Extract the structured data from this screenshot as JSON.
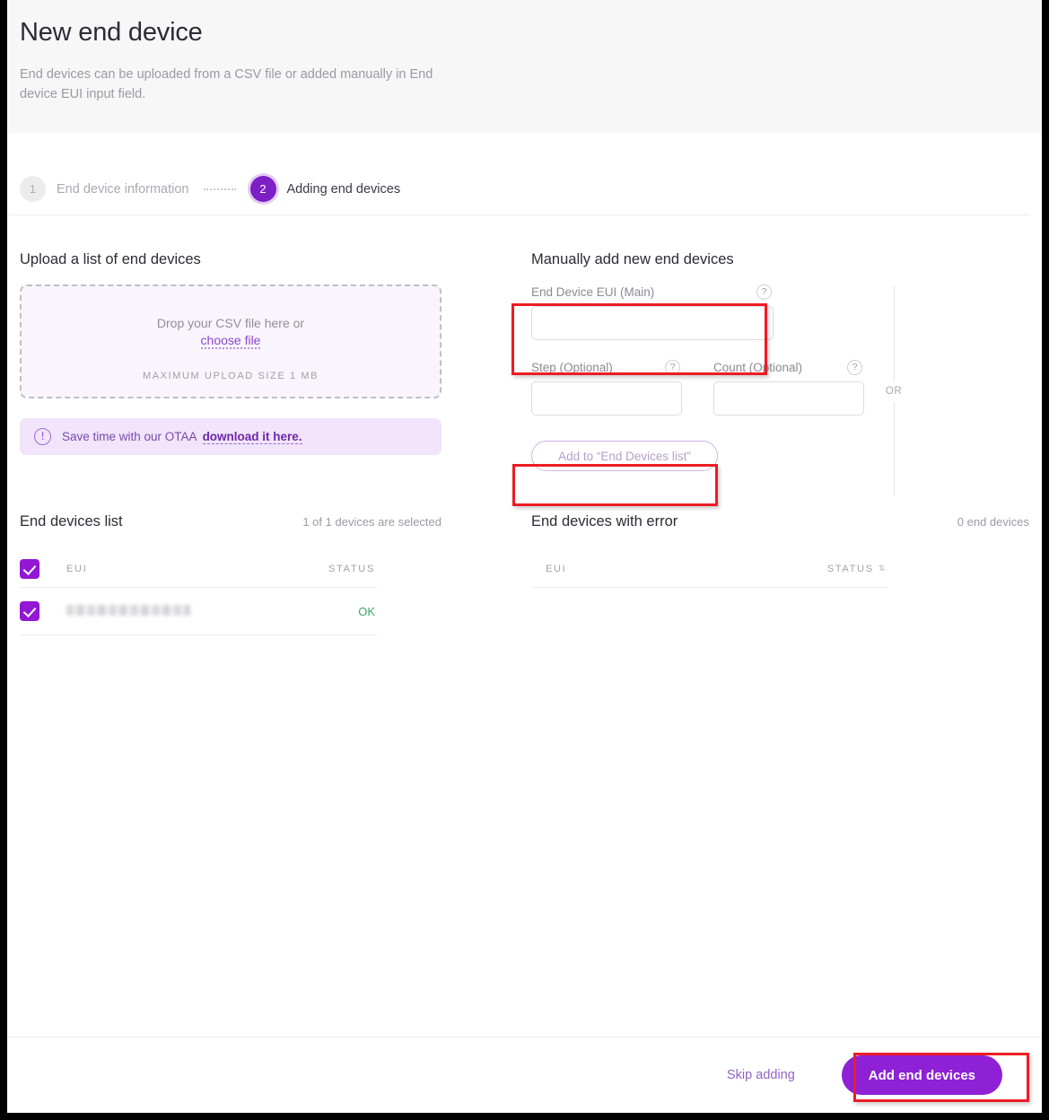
{
  "header": {
    "title": "New end device",
    "description": "End devices can be uploaded from a CSV file or added manually in End device EUI input field."
  },
  "stepper": {
    "steps": [
      {
        "number": "1",
        "label": "End device information",
        "state": "inactive"
      },
      {
        "number": "2",
        "label": "Adding end devices",
        "state": "active"
      }
    ]
  },
  "upload": {
    "title": "Upload a list of end devices",
    "drop_text": "Drop your CSV file here or",
    "choose_file_label": "choose file",
    "max_size_text": "MAXIMUM UPLOAD SIZE 1 MB",
    "banner": {
      "icon": "exclamation-circle-icon",
      "text": "Save time with our OTAA",
      "link_label": "download it here."
    }
  },
  "divider": {
    "or_label": "OR"
  },
  "manual": {
    "title": "Manually add new end devices",
    "eui_field": {
      "label": "End Device EUI (Main)",
      "value": "",
      "placeholder": "",
      "help_icon": "?"
    },
    "step_field": {
      "label": "Step (Optional)",
      "value": "",
      "placeholder": "",
      "help_icon": "?"
    },
    "count_field": {
      "label": "Count (Optional)",
      "value": "",
      "placeholder": "",
      "help_icon": "?"
    },
    "add_button_label": "Add to “End Devices list”"
  },
  "devices_list": {
    "title": "End devices list",
    "meta": "1 of 1 devices are selected",
    "columns": {
      "eui": "EUI",
      "status": "STATUS"
    },
    "rows": [
      {
        "eui": "",
        "status": "OK",
        "checked": true
      }
    ]
  },
  "devices_error_list": {
    "title": "End devices with error",
    "meta": "0 end devices",
    "columns": {
      "eui": "EUI",
      "status": "STATUS",
      "sort_icon": "⇅"
    },
    "rows": []
  },
  "footer": {
    "skip_label": "Skip adding",
    "primary_label": "Add end devices"
  },
  "colors": {
    "accent": "#8e20d6",
    "accent_dark": "#7c1fc4",
    "checkbox": "#9317d4",
    "highlight": "#ed1c24",
    "status_ok": "#3fa86b",
    "header_bg": "#f7f7f8",
    "dropzone_bg": "#faf5fd",
    "banner_bg": "#f1e4fb"
  }
}
